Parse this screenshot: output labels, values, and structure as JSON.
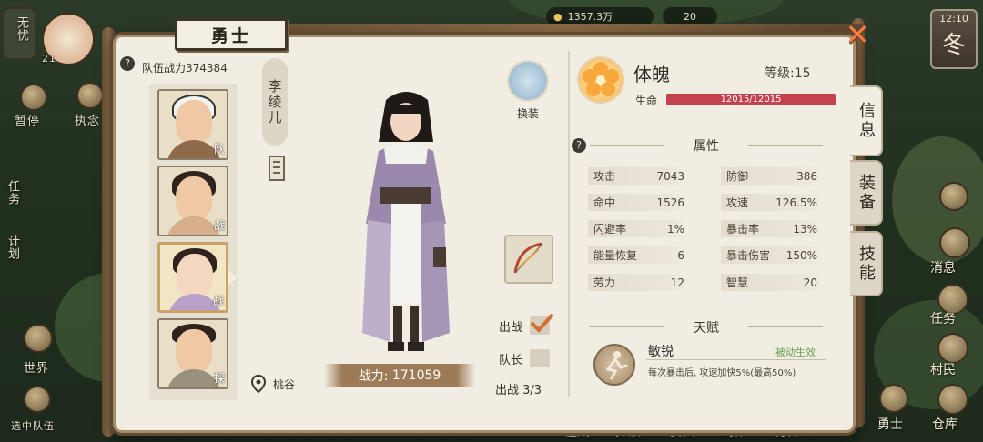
{
  "hud": {
    "left_top_label": "无忧",
    "left_count": "21",
    "currency_value": "1357.3万",
    "gem_value": "20",
    "time": "12:10",
    "season": "冬",
    "left_rail_labels": [
      "暂停",
      "执念",
      "任务",
      "计划",
      "世界",
      "选中队伍"
    ],
    "right_rail_labels": [
      "消息",
      "任务",
      "村民",
      "勇士",
      "仓库"
    ],
    "bottom_labels": [
      "征战",
      "探索",
      "宴宾",
      "制作",
      "材料"
    ]
  },
  "dialog": {
    "title": "勇士",
    "team_power_label": "队伍战力",
    "team_power_value": "374384",
    "close_label": "✕"
  },
  "roster": [
    {
      "tag": "队"
    },
    {
      "tag": "战"
    },
    {
      "tag": "战"
    },
    {
      "tag": "探"
    }
  ],
  "hero": {
    "name": "李绫儿",
    "combat_power_label": "战力:",
    "combat_power_value": "171059",
    "location": "桃谷",
    "outfit_label": "换装",
    "deploy_label": "出战",
    "deploy_checked": true,
    "captain_label": "队长",
    "captain_checked": false,
    "deploy_count_label": "出战",
    "deploy_count_value": "3/3"
  },
  "info": {
    "soul_name": "体魄",
    "level_label": "等级:15",
    "hp_label": "生命",
    "hp_text": "12015/12015",
    "hp_fraction": 1.0,
    "hp_color": "#c2424e",
    "attributes_title": "属性",
    "stats": [
      {
        "label": "攻击",
        "value": "7043"
      },
      {
        "label": "防御",
        "value": "386"
      },
      {
        "label": "命中",
        "value": "1526"
      },
      {
        "label": "攻速",
        "value": "126.5%"
      },
      {
        "label": "闪避率",
        "value": "1%"
      },
      {
        "label": "暴击率",
        "value": "13%"
      },
      {
        "label": "能量恢复",
        "value": "6"
      },
      {
        "label": "暴击伤害",
        "value": "150%"
      },
      {
        "label": "劳力",
        "value": "12"
      },
      {
        "label": "智慧",
        "value": "20"
      }
    ],
    "talent_title": "天赋",
    "talent_name": "敏锐",
    "talent_type": "被动生效",
    "talent_desc": "每次暴击后, 攻速加快5%(最高50%)"
  },
  "tabs": [
    {
      "label": "信息",
      "active": true
    },
    {
      "label": "装备",
      "active": false
    },
    {
      "label": "技能",
      "active": false
    }
  ]
}
